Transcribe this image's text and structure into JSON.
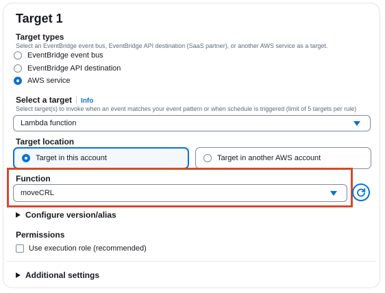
{
  "title": "Target 1",
  "target_types": {
    "label": "Target types",
    "description": "Select an EventBridge event bus, EventBridge API destination (SaaS partner), or another AWS service as a target.",
    "options": [
      "EventBridge event bus",
      "EventBridge API destination",
      "AWS service"
    ],
    "selected": "AWS service"
  },
  "select_target": {
    "label": "Select a target",
    "info": "Info",
    "description": "Select target(s) to invoke when an event matches your event pattern or when schedule is triggered (limit of 5 targets per rule)",
    "value": "Lambda function"
  },
  "target_location": {
    "label": "Target location",
    "options": [
      "Target in this account",
      "Target in another AWS account"
    ],
    "selected": "Target in this account"
  },
  "function": {
    "label": "Function",
    "value": "moveCRL"
  },
  "configure_version": "Configure version/alias",
  "permissions": {
    "label": "Permissions",
    "checkbox_label": "Use execution role (recommended)",
    "checked": false
  },
  "additional_settings": "Additional settings",
  "colors": {
    "accent": "#0972d3",
    "highlight": "#d9472b",
    "border": "#7d8998",
    "muted_text": "#5f6b7a"
  }
}
